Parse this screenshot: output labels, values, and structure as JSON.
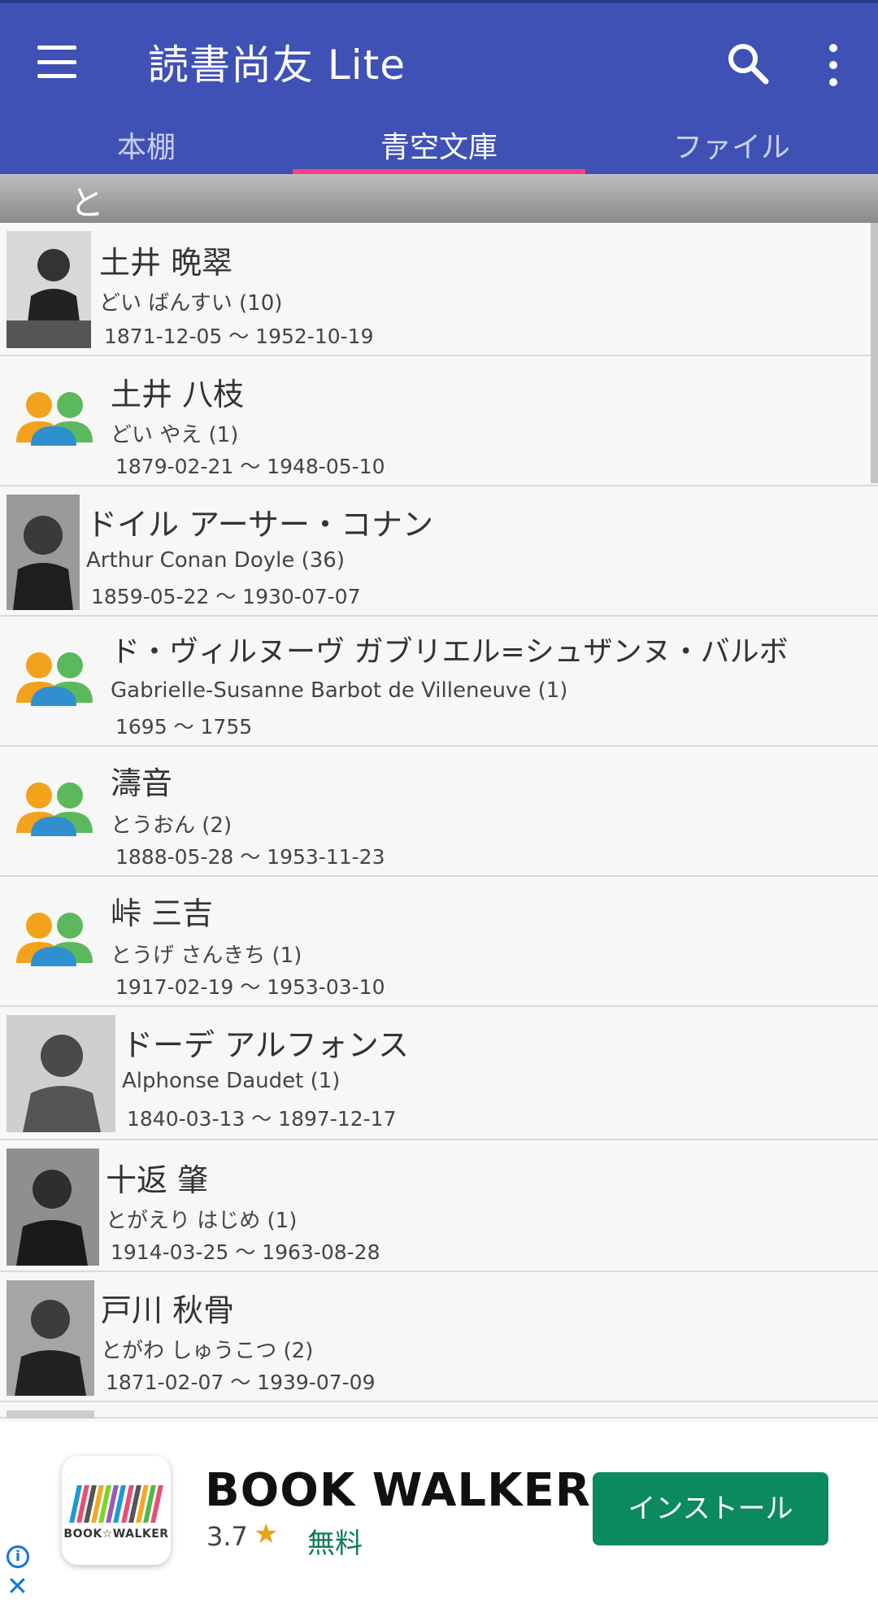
{
  "app": {
    "title": "読書尚友 Lite"
  },
  "tabs": [
    {
      "label": "本棚"
    },
    {
      "label": "青空文庫"
    },
    {
      "label": "ファイル"
    }
  ],
  "active_tab": 1,
  "section": {
    "label": "と"
  },
  "authors": [
    {
      "name": "土井 晩翠",
      "reading": "どい ばんすい (10)",
      "dates": "1871-12-05 〜 1952-10-19",
      "icon": "portrait"
    },
    {
      "name": "土井 八枝",
      "reading": "どい やえ (1)",
      "dates": "1879-02-21 〜 1948-05-10",
      "icon": "group-icon"
    },
    {
      "name": "ドイル アーサー・コナン",
      "reading": "Arthur Conan Doyle (36)",
      "dates": "1859-05-22 〜 1930-07-07",
      "icon": "portrait"
    },
    {
      "name": "ド・ヴィルヌーヴ ガブリエル=シュザンヌ・バルボ",
      "reading": "Gabrielle-Susanne Barbot de Villeneuve (1)",
      "dates": "1695 〜 1755",
      "icon": "group-icon"
    },
    {
      "name": "濤音",
      "reading": "とうおん (2)",
      "dates": "1888-05-28 〜 1953-11-23",
      "icon": "group-icon"
    },
    {
      "name": "峠 三吉",
      "reading": "とうげ さんきち (1)",
      "dates": "1917-02-19 〜 1953-03-10",
      "icon": "group-icon"
    },
    {
      "name": "ドーデ アルフォンス",
      "reading": "Alphonse Daudet (1)",
      "dates": "1840-03-13 〜 1897-12-17",
      "icon": "portrait"
    },
    {
      "name": "十返 肇",
      "reading": "とがえり はじめ (1)",
      "dates": "1914-03-25 〜 1963-08-28",
      "icon": "portrait"
    },
    {
      "name": "戸川 秋骨",
      "reading": "とがわ しゅうこつ (2)",
      "dates": "1871-02-07 〜 1939-07-09",
      "icon": "portrait"
    }
  ],
  "ad": {
    "app_name": "BOOK WALKER",
    "icon_brand": "BOOK☆WALKER",
    "rating": "3.7",
    "star": "★",
    "price": "無料",
    "install_label": "インストール",
    "bar_colors": [
      "#1b9ad6",
      "#e94e77",
      "#555555",
      "#f5a623",
      "#7ed321",
      "#9b59b6",
      "#1b9ad6",
      "#e94e77",
      "#555555",
      "#f5a623",
      "#50b848",
      "#e94e77"
    ]
  },
  "colors": {
    "primary": "#3f51b5",
    "accent": "#ff4081",
    "install": "#0b8a5e"
  }
}
